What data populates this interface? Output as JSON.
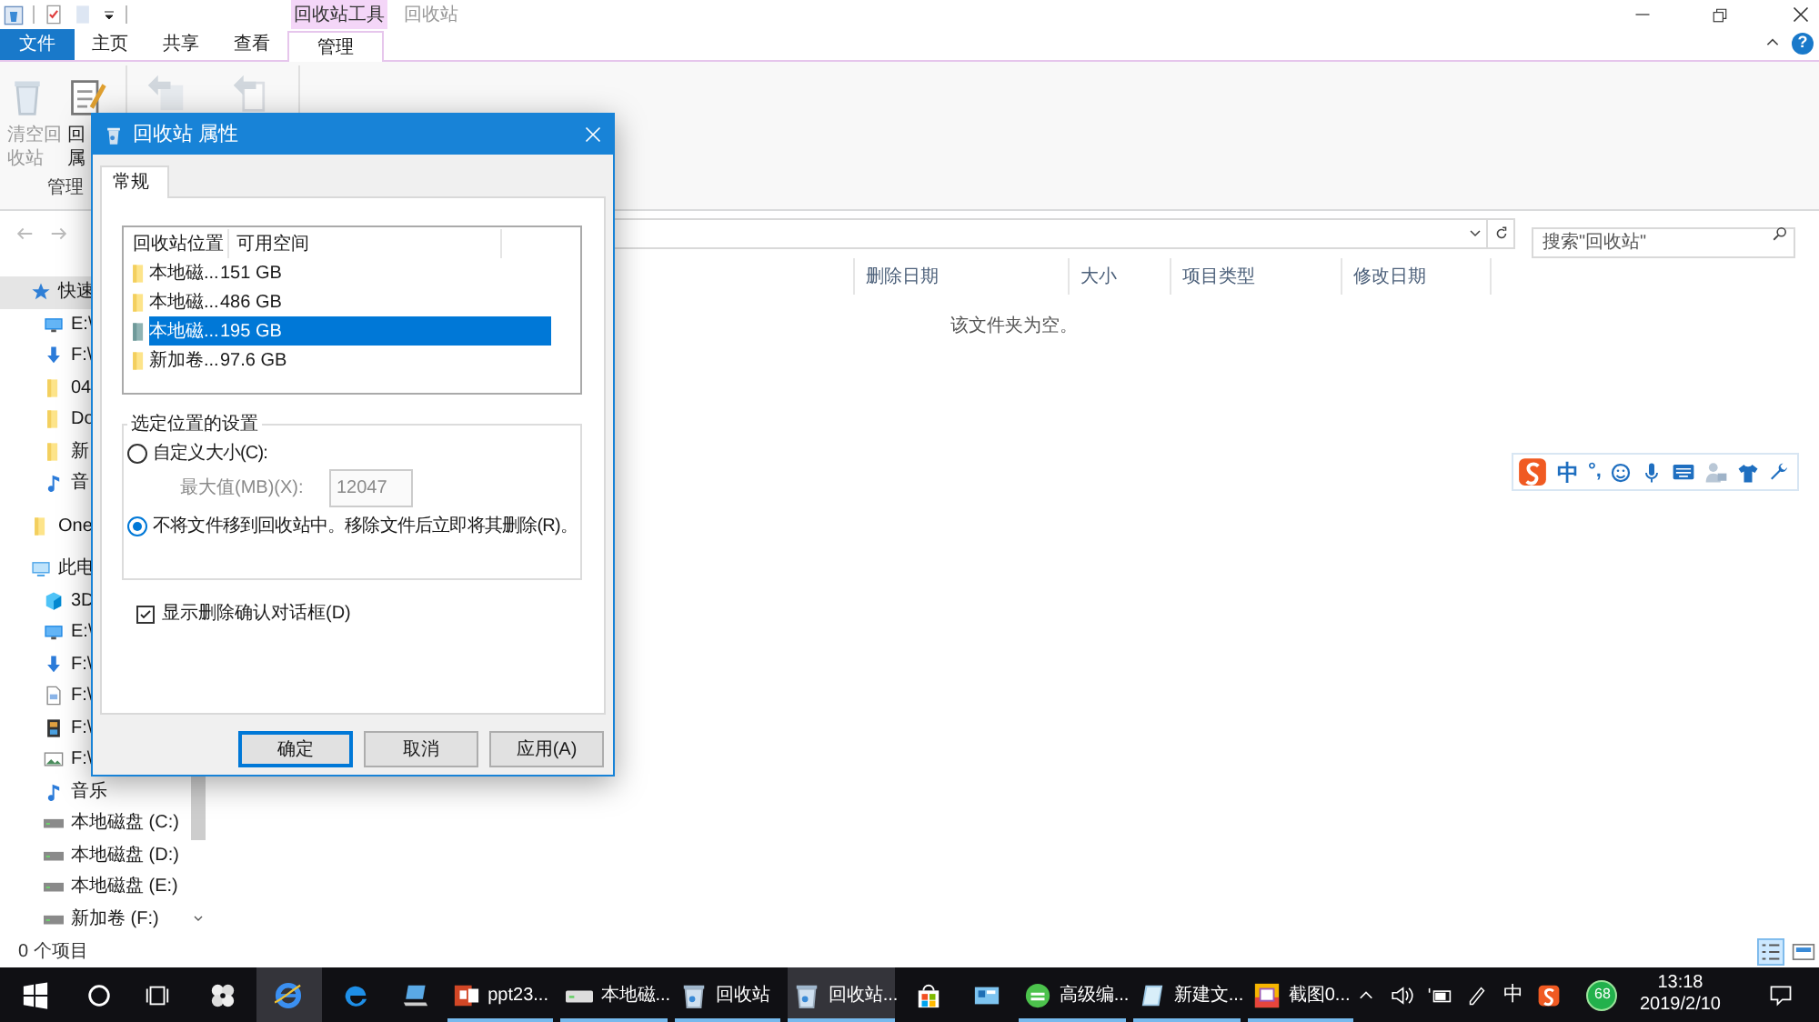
{
  "title_bar": {
    "contextual_group": "回收站工具",
    "title": "回收站"
  },
  "ribbon_tabs": [
    {
      "label": "文件",
      "kind": "file",
      "selected": false
    },
    {
      "label": "主页",
      "kind": "tab",
      "selected": false
    },
    {
      "label": "共享",
      "kind": "tab",
      "selected": false
    },
    {
      "label": "查看",
      "kind": "tab",
      "selected": false
    },
    {
      "label": "管理",
      "kind": "contextual",
      "selected": true
    }
  ],
  "help_button": "?",
  "ribbon_buttons": [
    {
      "kind": "empty-bin",
      "lines": [
        "清空回",
        "收站"
      ],
      "disabled": true
    },
    {
      "kind": "properties",
      "lines": [
        "回",
        "属"
      ],
      "disabled": false
    },
    {
      "kind": "restore-all",
      "disabled": true
    },
    {
      "kind": "restore-selected",
      "disabled": true
    }
  ],
  "ribbon_group": "管理",
  "search": {
    "placeholder": "搜索\"回收站\""
  },
  "sidebar": [
    {
      "label": "快速",
      "kind": "star",
      "selected": true,
      "children": [
        {
          "label": "E:\\",
          "kind": "monitor",
          "selected": false
        },
        {
          "label": "F:\\",
          "kind": "download",
          "selected": false
        },
        {
          "label": "04",
          "kind": "folder",
          "selected": false
        },
        {
          "label": "Do",
          "kind": "folder",
          "selected": false
        },
        {
          "label": "新",
          "kind": "folder",
          "selected": false
        },
        {
          "label": "音",
          "kind": "music",
          "selected": false
        }
      ]
    },
    {
      "label": "One",
      "kind": "folder",
      "selected": false
    },
    {
      "label": "此电",
      "kind": "pc",
      "selected": false,
      "children": [
        {
          "label": "3D",
          "kind": "cube",
          "selected": false
        },
        {
          "label": "E:\\",
          "kind": "monitor",
          "selected": false
        },
        {
          "label": "F:\\",
          "kind": "download",
          "selected": false
        },
        {
          "label": "F:\\",
          "kind": "document",
          "selected": false
        },
        {
          "label": "F:\\",
          "kind": "video",
          "selected": false
        },
        {
          "label": "F:\\",
          "kind": "image",
          "selected": false
        },
        {
          "label": "音乐",
          "kind": "music",
          "selected": false
        },
        {
          "label": "本地磁盘 (C:)",
          "kind": "drive",
          "selected": false
        },
        {
          "label": "本地磁盘 (D:)",
          "kind": "drive",
          "selected": false
        },
        {
          "label": "本地磁盘 (E:)",
          "kind": "drive",
          "selected": false
        },
        {
          "label": "新加卷 (F:)",
          "kind": "drive",
          "selected": false
        }
      ]
    }
  ],
  "columns": [
    "删除日期",
    "大小",
    "项目类型",
    "修改日期"
  ],
  "empty_message": "该文件夹为空。",
  "ime_toolbar": {
    "mode": "中",
    "punctuation": "°,"
  },
  "status_bar": {
    "item_count": "0 个项目"
  },
  "dialog": {
    "title": "回收站 属性",
    "tabs": [
      {
        "label": "常规",
        "selected": true
      }
    ],
    "list_columns": [
      "回收站位置",
      "可用空间"
    ],
    "locations": [
      {
        "name": "本地磁...",
        "space": "151 GB",
        "selected": false
      },
      {
        "name": "本地磁...",
        "space": "486 GB",
        "selected": false
      },
      {
        "name": "本地磁...",
        "space": "195 GB",
        "selected": true
      },
      {
        "name": "新加卷...",
        "space": "97.6 GB",
        "selected": false
      }
    ],
    "group_title": "选定位置的设置",
    "options": [
      {
        "label": "自定义大小(C):",
        "selected": false
      },
      {
        "label": "不将文件移到回收站中。移除文件后立即将其删除(R)。",
        "selected": true
      }
    ],
    "max_size": {
      "label": "最大值(MB)(X):",
      "value": "12047",
      "disabled": true
    },
    "confirm": {
      "label": "显示删除确认对话框(D)",
      "checked": true
    },
    "buttons": [
      {
        "label": "确定",
        "default": true
      },
      {
        "label": "取消",
        "default": false
      },
      {
        "label": "应用(A)",
        "default": false
      }
    ]
  },
  "taskbar": {
    "items": [
      {
        "kind": "start",
        "running": false,
        "active": false
      },
      {
        "kind": "search",
        "running": false,
        "active": false
      },
      {
        "kind": "taskview",
        "running": false,
        "active": false
      },
      {
        "kind": "fan",
        "running": false,
        "active": false
      },
      {
        "kind": "ie",
        "running": false,
        "active": true
      },
      {
        "kind": "edge",
        "running": false,
        "active": false
      },
      {
        "kind": "laptop",
        "running": false,
        "active": false
      },
      {
        "kind": "ppt",
        "label": "ppt23...",
        "running": true,
        "active": false
      },
      {
        "kind": "drive",
        "label": "本地磁...",
        "running": true,
        "active": false
      },
      {
        "kind": "bin",
        "label": "回收站",
        "running": true,
        "active": false
      },
      {
        "kind": "bin",
        "label": "回收站...",
        "running": true,
        "active": true
      },
      {
        "kind": "store",
        "running": false,
        "active": false
      },
      {
        "kind": "panel",
        "running": false,
        "active": false
      },
      {
        "kind": "green",
        "label": "高级编...",
        "running": true,
        "active": false
      },
      {
        "kind": "notepad",
        "label": "新建文...",
        "running": true,
        "active": false
      },
      {
        "kind": "snip",
        "label": "截图0...",
        "running": true,
        "active": false
      }
    ],
    "tray": {
      "input_mode": "中",
      "badge": "68",
      "time": "13:18",
      "date": "2019/2/10"
    }
  }
}
